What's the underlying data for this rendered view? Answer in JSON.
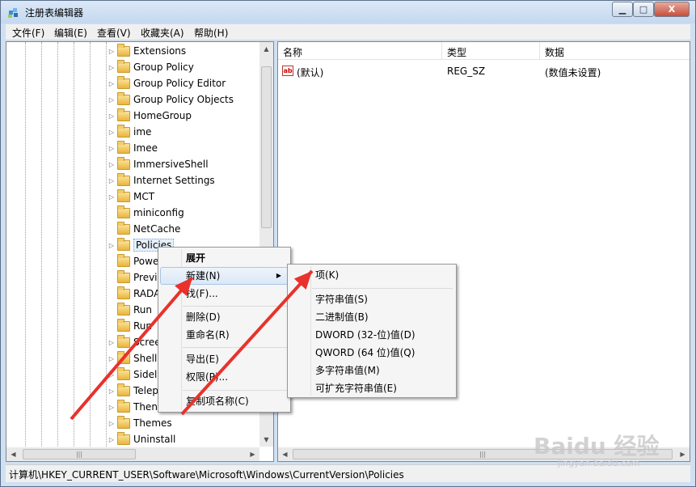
{
  "window": {
    "title": "注册表编辑器"
  },
  "title_controls": {
    "minimize": "▁",
    "maximize": "□",
    "close": "X"
  },
  "menu": [
    {
      "label": "文件(F)"
    },
    {
      "label": "编辑(E)"
    },
    {
      "label": "查看(V)"
    },
    {
      "label": "收藏夹(A)"
    },
    {
      "label": "帮助(H)"
    }
  ],
  "tree": {
    "items": [
      {
        "label": "Extensions",
        "expandable": true
      },
      {
        "label": "Group Policy",
        "expandable": true
      },
      {
        "label": "Group Policy Editor",
        "expandable": true
      },
      {
        "label": "Group Policy Objects",
        "expandable": true
      },
      {
        "label": "HomeGroup",
        "expandable": true
      },
      {
        "label": "ime",
        "expandable": true
      },
      {
        "label": "Imee",
        "expandable": true
      },
      {
        "label": "ImmersiveShell",
        "expandable": true
      },
      {
        "label": "Internet Settings",
        "expandable": true
      },
      {
        "label": "MCT",
        "expandable": true
      },
      {
        "label": "miniconfig",
        "expandable": false
      },
      {
        "label": "NetCache",
        "expandable": false
      },
      {
        "label": "Policies",
        "expandable": true,
        "selected": true
      },
      {
        "label": "Powe",
        "expandable": false
      },
      {
        "label": "Previ",
        "expandable": false
      },
      {
        "label": "RADA",
        "expandable": false
      },
      {
        "label": "Run",
        "expandable": false
      },
      {
        "label": "Run",
        "expandable": false
      },
      {
        "label": "Scree",
        "expandable": true
      },
      {
        "label": "Shell",
        "expandable": true
      },
      {
        "label": "Sidel",
        "expandable": true
      },
      {
        "label": "Telep",
        "expandable": true
      },
      {
        "label": "Then",
        "expandable": true
      },
      {
        "label": "Themes",
        "expandable": true
      },
      {
        "label": "Uninstall",
        "expandable": true
      }
    ]
  },
  "list": {
    "columns": {
      "name": "名称",
      "type": "类型",
      "data": "数据"
    },
    "rows": [
      {
        "icon": "ab",
        "name": "(默认)",
        "type": "REG_SZ",
        "data": "(数值未设置)"
      }
    ]
  },
  "context_menu": {
    "items": [
      {
        "label": "展开",
        "bold": true
      },
      {
        "label": "新建(N)",
        "highlighted": true,
        "submenu": true
      },
      {
        "label": "找(F)..."
      },
      {
        "label": "删除(D)"
      },
      {
        "label": "重命名(R)"
      },
      {
        "label": "导出(E)"
      },
      {
        "label": "权限(P)..."
      },
      {
        "label": "复制项名称(C)"
      }
    ]
  },
  "submenu": {
    "items": [
      {
        "label": "项(K)"
      },
      {
        "label": "字符串值(S)"
      },
      {
        "label": "二进制值(B)"
      },
      {
        "label": "DWORD (32-位)值(D)"
      },
      {
        "label": "QWORD (64 位)值(Q)"
      },
      {
        "label": "多字符串值(M)"
      },
      {
        "label": "可扩充字符串值(E)"
      }
    ]
  },
  "status": {
    "path": "计算机\\HKEY_CURRENT_USER\\Software\\Microsoft\\Windows\\CurrentVersion\\Policies"
  },
  "watermark": {
    "text": "Baidu 经验",
    "sub": "jingyan.baidu.com"
  },
  "colors": {
    "annotation_arrow": "#e8322b",
    "selection": "#dbe8f7"
  },
  "icons": {
    "folder": "folder-icon",
    "app": "registry-editor-icon",
    "value": "string-value-icon"
  }
}
